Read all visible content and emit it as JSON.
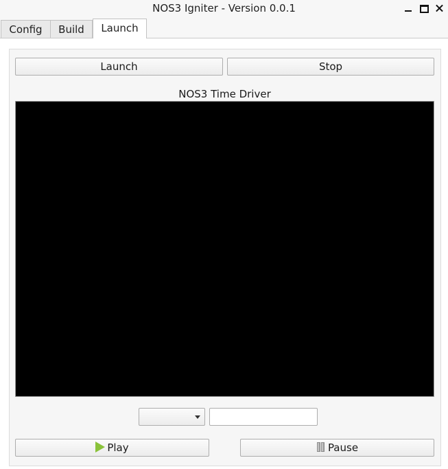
{
  "window": {
    "title": "NOS3 Igniter - Version 0.0.1"
  },
  "tabs": [
    {
      "label": "Config"
    },
    {
      "label": "Build"
    },
    {
      "label": "Launch"
    }
  ],
  "launch": {
    "launch_label": "Launch",
    "stop_label": "Stop",
    "time_driver_title": "NOS3 Time Driver",
    "combo_value": "",
    "text_value": "",
    "play_label": "Play",
    "pause_label": "Pause"
  },
  "icons": {
    "play": "play-icon",
    "pause": "pause-icon",
    "minimize": "minimize-icon",
    "maximize": "maximize-icon",
    "close": "close-icon"
  },
  "colors": {
    "terminal_background": "#000000",
    "play_icon": "#8ac23a"
  }
}
